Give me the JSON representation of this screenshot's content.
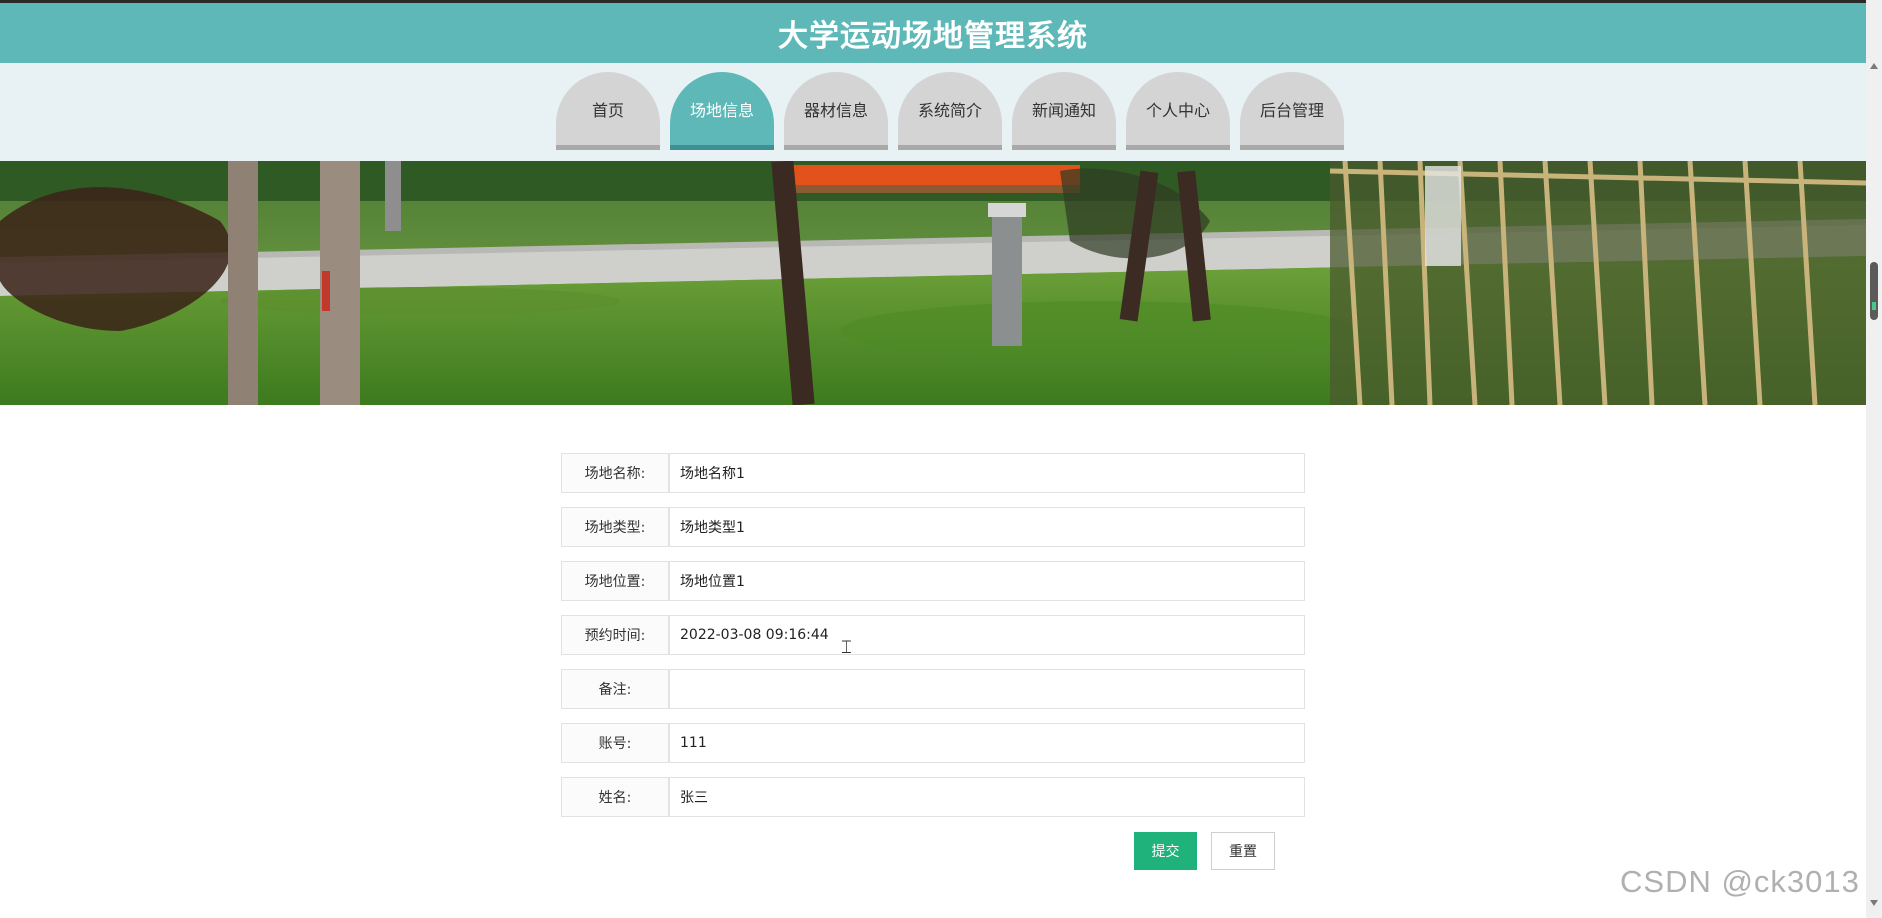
{
  "header": {
    "title": "大学运动场地管理系统"
  },
  "nav": {
    "items": [
      {
        "label": "首页",
        "active": false
      },
      {
        "label": "场地信息",
        "active": true
      },
      {
        "label": "器材信息",
        "active": false
      },
      {
        "label": "系统简介",
        "active": false
      },
      {
        "label": "新闻通知",
        "active": false
      },
      {
        "label": "个人中心",
        "active": false
      },
      {
        "label": "后台管理",
        "active": false
      }
    ]
  },
  "form": {
    "fields": [
      {
        "label": "场地名称:",
        "value": "场地名称1"
      },
      {
        "label": "场地类型:",
        "value": "场地类型1"
      },
      {
        "label": "场地位置:",
        "value": "场地位置1"
      },
      {
        "label": "预约时间:",
        "value": "2022-03-08 09:16:44"
      },
      {
        "label": "备注:",
        "value": ""
      },
      {
        "label": "账号:",
        "value": "111"
      },
      {
        "label": "姓名:",
        "value": "张三"
      }
    ],
    "submit_label": "提交",
    "reset_label": "重置"
  },
  "colors": {
    "header": "#5fb8b8",
    "nav_bg": "#e8f1f3",
    "tab_inactive": "#d4d4d4",
    "tab_active": "#5fb8b8",
    "submit": "#1fb27a"
  },
  "watermark": "CSDN @ck3013"
}
